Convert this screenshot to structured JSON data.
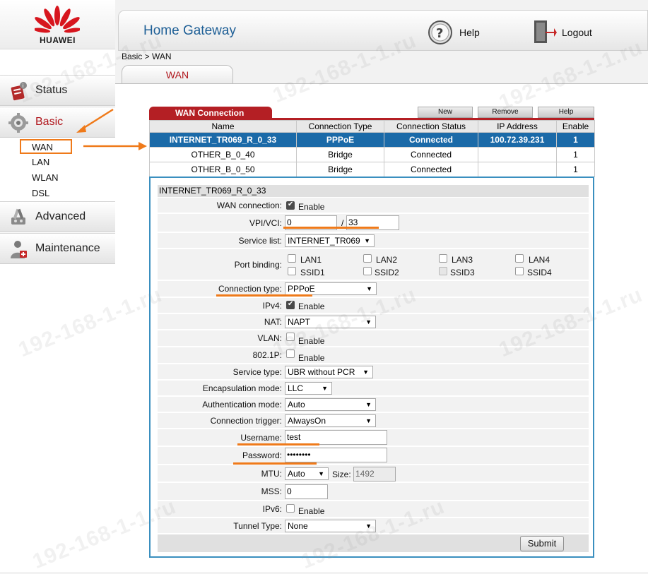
{
  "brand": "HUAWEI",
  "header": {
    "title": "Home Gateway",
    "help": "Help",
    "logout": "Logout"
  },
  "breadcrumb": "Basic > WAN",
  "page_tab": "WAN",
  "sidebar": {
    "status": "Status",
    "basic": "Basic",
    "basic_items": [
      "WAN",
      "LAN",
      "WLAN",
      "DSL"
    ],
    "advanced": "Advanced",
    "maintenance": "Maintenance"
  },
  "table": {
    "tab": "WAN Connection",
    "buttons": [
      "New",
      "Remove",
      "Help"
    ],
    "columns": [
      "Name",
      "Connection Type",
      "Connection Status",
      "IP Address",
      "Enable"
    ],
    "rows": [
      [
        "INTERNET_TR069_R_0_33",
        "PPPoE",
        "Connected",
        "100.72.39.231",
        "1"
      ],
      [
        "OTHER_B_0_40",
        "Bridge",
        "Connected",
        "",
        "1"
      ],
      [
        "OTHER_B_0_50",
        "Bridge",
        "Connected",
        "",
        "1"
      ]
    ]
  },
  "form": {
    "heading": "INTERNET_TR069_R_0_33",
    "wan_connection_label": "WAN connection:",
    "enable_text": "Enable",
    "vpi_vci_label": "VPI/VCI:",
    "vpi": "0",
    "vci_sep": "/",
    "vci": "33",
    "service_list_label": "Service list:",
    "service_list": "INTERNET_TR069",
    "port_binding_label": "Port binding:",
    "ports": [
      "LAN1",
      "LAN2",
      "LAN3",
      "LAN4",
      "SSID1",
      "SSID2",
      "SSID3",
      "SSID4"
    ],
    "connection_type_label": "Connection type:",
    "connection_type": "PPPoE",
    "ipv4_label": "IPv4:",
    "nat_label": "NAT:",
    "nat": "NAPT",
    "vlan_label": "VLAN:",
    "p8021_label": "802.1P:",
    "service_type_label": "Service type:",
    "service_type": "UBR without PCR",
    "encapsulation_label": "Encapsulation mode:",
    "encapsulation": "LLC",
    "auth_label": "Authentication mode:",
    "auth": "Auto",
    "trigger_label": "Connection trigger:",
    "trigger": "AlwaysOn",
    "username_label": "Username:",
    "username": "test",
    "password_label": "Password:",
    "password": "••••••••",
    "mtu_label": "MTU:",
    "mtu": "Auto",
    "size_label": "Size:",
    "size": "1492",
    "mss_label": "MSS:",
    "mss": "0",
    "ipv6_label": "IPv6:",
    "tunnel_label": "Tunnel Type:",
    "tunnel": "None",
    "submit": "Submit"
  },
  "watermark": [
    "192-168-1-1.ru",
    "192-168-1-1.ru"
  ],
  "colors": {
    "accent_red": "#b41f24",
    "selected_blue": "#1b6aa8",
    "highlight_orange": "#ef7a1a",
    "title_blue": "#1e5f96"
  }
}
